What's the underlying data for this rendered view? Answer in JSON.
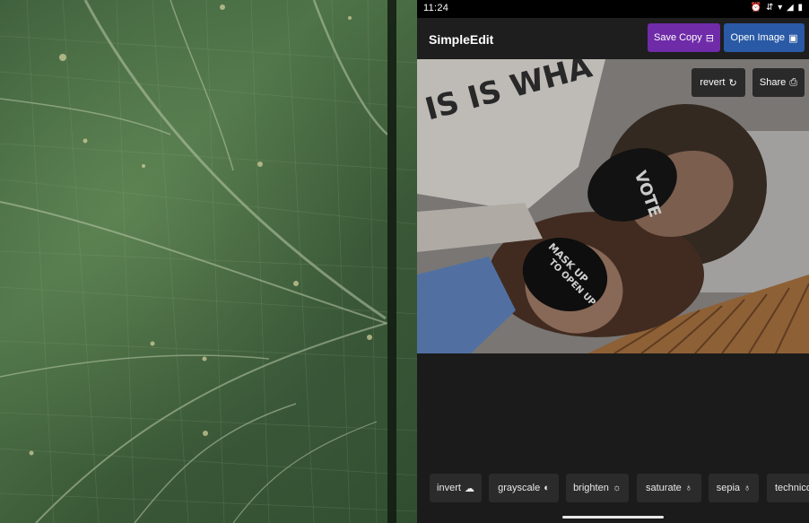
{
  "status_bar": {
    "time": "11:24",
    "icons_glyph": "⏰ ⇵ ▾ ◢ ▮",
    "icons": [
      "alarm-icon",
      "data-icon",
      "wifi-icon",
      "signal-icon",
      "battery-icon"
    ]
  },
  "app": {
    "title": "SimpleEdit"
  },
  "toolbar": {
    "save_label": "Save Copy",
    "save_icon_glyph": "⊟",
    "open_label": "Open Image",
    "open_icon_glyph": "▣"
  },
  "image_actions": {
    "revert_label": "revert",
    "revert_icon_glyph": "↻",
    "share_label": "Share",
    "share_icon_glyph": "⎙"
  },
  "filters": [
    {
      "label": "invert",
      "icon": "☁"
    },
    {
      "label": "grayscale",
      "icon": "◐"
    },
    {
      "label": "brighten",
      "icon": "☼"
    },
    {
      "label": "saturate",
      "icon": "♁"
    },
    {
      "label": "sepia",
      "icon": "♁"
    },
    {
      "label": "technico",
      "icon": ""
    }
  ],
  "colors": {
    "save_button": "#6f2ba8",
    "open_button": "#2a5aa6",
    "app_background": "#1b1b1b"
  }
}
